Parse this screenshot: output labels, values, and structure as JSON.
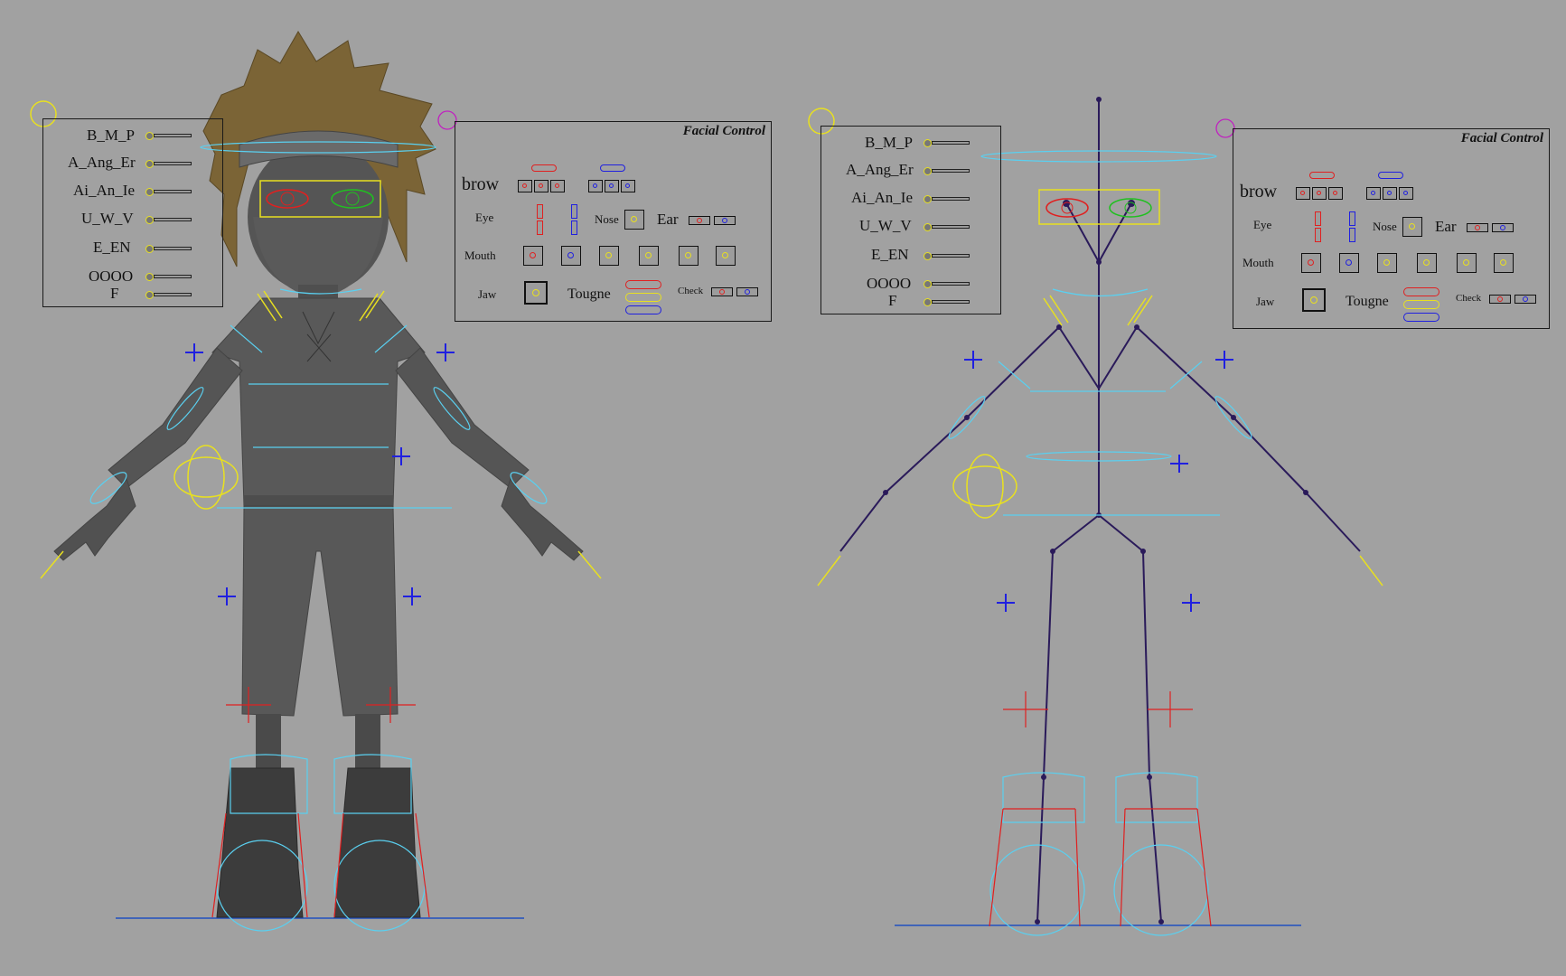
{
  "visemes": {
    "labels": [
      "B_M_P",
      "A_Ang_Er",
      "Ai_An_Ie",
      "U_W_V",
      "E_EN",
      "OOOO",
      "F"
    ]
  },
  "facial_control": {
    "title": "Facial Control",
    "brow": "brow",
    "eye": "Eye",
    "nose": "Nose",
    "ear": "Ear",
    "mouth": "Mouth",
    "jaw": "Jaw",
    "tongue": "Tougne",
    "cheek": "Check"
  },
  "colors": {
    "background": "#a1a1a1",
    "control_blue": "#5ad0f0",
    "control_yellow": "#e8e020",
    "control_red": "#e02020",
    "control_green": "#20c020",
    "joint_purple": "#2a1a5a",
    "plus_blue": "#2020e0"
  }
}
